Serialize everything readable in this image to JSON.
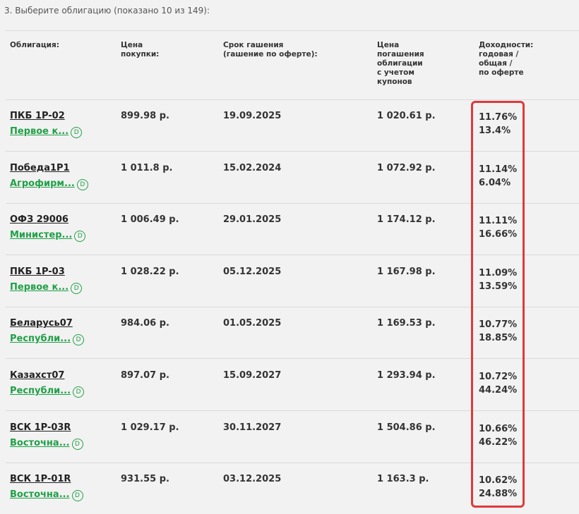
{
  "step_title": "3. Выберите облигацию (показано 10 из 149):",
  "headers": {
    "bond": "Облигация:",
    "price": "Цена\nпокупки:",
    "maturity": "Срок гашения\n(гашение по оферте):",
    "redemption": "Цена\nпогашения\nоблигации\nс учетом\nкупонов",
    "yield": "Доходности:\nгодовая /\nобщая /\nпо оферте"
  },
  "rows": [
    {
      "name": "ПКБ 1P-02",
      "issuer": "Первое к...",
      "price": "899.98 р.",
      "maturity": "19.09.2025",
      "redemption": "1 020.61 р.",
      "yield_annual": "11.76%",
      "yield_total": "13.4%"
    },
    {
      "name": "Победа1P1",
      "issuer": "Агрофирм...",
      "price": "1 011.8 р.",
      "maturity": "15.02.2024",
      "redemption": "1 072.92 р.",
      "yield_annual": "11.14%",
      "yield_total": "6.04%"
    },
    {
      "name": "ОФЗ 29006",
      "issuer": "Министер...",
      "price": "1 006.49 р.",
      "maturity": "29.01.2025",
      "redemption": "1 174.12 р.",
      "yield_annual": "11.11%",
      "yield_total": "16.66%"
    },
    {
      "name": "ПКБ 1P-03",
      "issuer": "Первое к...",
      "price": "1 028.22 р.",
      "maturity": "05.12.2025",
      "redemption": "1 167.98 р.",
      "yield_annual": "11.09%",
      "yield_total": "13.59%"
    },
    {
      "name": "Беларусь07",
      "issuer": "Республи...",
      "price": "984.06 р.",
      "maturity": "01.05.2025",
      "redemption": "1 169.53 р.",
      "yield_annual": "10.77%",
      "yield_total": "18.85%"
    },
    {
      "name": "Казахст07",
      "issuer": "Республи...",
      "price": "897.07 р.",
      "maturity": "15.09.2027",
      "redemption": "1 293.94 р.",
      "yield_annual": "10.72%",
      "yield_total": "44.24%"
    },
    {
      "name": "ВСК 1P-03R",
      "issuer": "Восточна...",
      "price": "1 029.17 р.",
      "maturity": "30.11.2027",
      "redemption": "1 504.86 р.",
      "yield_annual": "10.66%",
      "yield_total": "46.22%"
    },
    {
      "name": "ВСК 1P-01R",
      "issuer": "Восточна...",
      "price": "931.55 р.",
      "maturity": "03.12.2025",
      "redemption": "1 163.3 р.",
      "yield_annual": "10.62%",
      "yield_total": "24.88%"
    }
  ],
  "icon_label": "D",
  "colors": {
    "background": "#f2f2f2",
    "issuer_link": "#1fa047",
    "highlight": "#e0393a",
    "divider": "#d9d9d9"
  }
}
